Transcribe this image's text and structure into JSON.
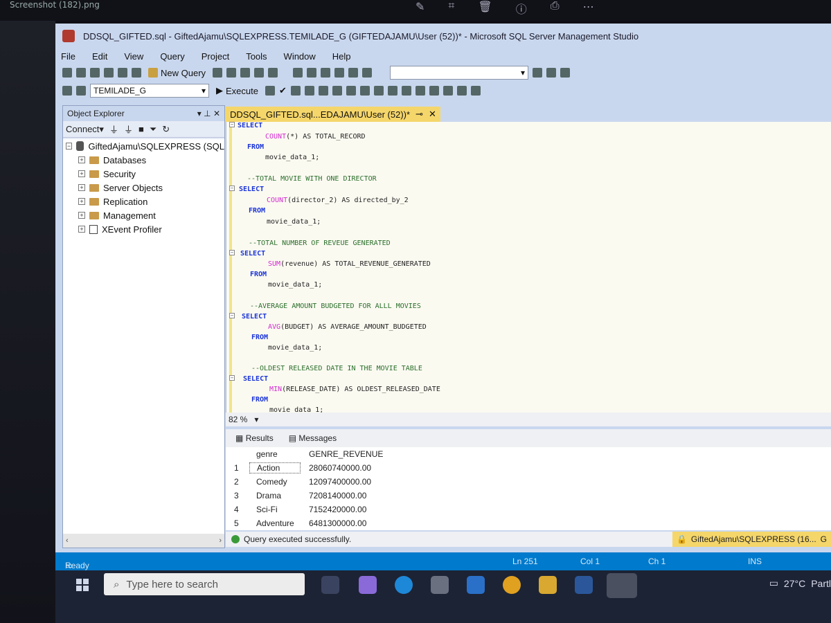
{
  "os": {
    "screenshot_file": "Screenshot (182).png"
  },
  "window": {
    "title": "DDSQL_GIFTED.sql - GiftedAjamu\\SQLEXPRESS.TEMILADE_G (GIFTEDAJAMU\\User (52))* - Microsoft SQL Server Management Studio"
  },
  "menu": [
    "File",
    "Edit",
    "View",
    "Query",
    "Project",
    "Tools",
    "Window",
    "Help"
  ],
  "toolbar": {
    "new_query_label": "New Query",
    "database_selected": "TEMILADE_G",
    "execute_label": "Execute"
  },
  "object_explorer": {
    "title": "Object Explorer",
    "connect_label": "Connect",
    "server_node": "GiftedAjamu\\SQLEXPRESS (SQL",
    "children": [
      "Databases",
      "Security",
      "Server Objects",
      "Replication",
      "Management",
      "XEvent Profiler"
    ]
  },
  "editor": {
    "tab_label": "DDSQL_GIFTED.sql...EDAJAMU\\User (52))*",
    "zoom": "82 %"
  },
  "code": {
    "l1_kw": "SELECT",
    "l2_fn": "COUNT",
    "l2_rest": "(*) AS TOTAL_RECORD",
    "l3_kw": "FROM",
    "l4": "movie_data_1;",
    "c1": "--TOTAL MOVIE WITH ONE DIRECTOR",
    "l6_kw": "SELECT",
    "l7_fn": "COUNT",
    "l7_rest": "(director_2) AS directed_by_2",
    "l8_kw": "FROM",
    "l9": "movie_data_1;",
    "c2": "--TOTAL NUMBER OF REVEUE GENERATED",
    "l11_kw": "SELECT",
    "l12_fn": "SUM",
    "l12_rest": "(revenue) AS TOTAL_REVENUE_GENERATED",
    "l13_kw": "FROM",
    "l14": "movie_data_1;",
    "c3": "--AVERAGE AMOUNT BUDGETED FOR ALLL MOVIES",
    "l16_kw": "SELECT",
    "l17_fn": "AVG",
    "l17_rest": "(BUDGET) AS AVERAGE_AMOUNT_BUDGETED",
    "l18_kw": "FROM",
    "l19": "movie_data_1;",
    "c4": "--OLDEST RELEASED DATE IN THE MOVIE TABLE",
    "l21_kw": "SELECT",
    "l22_fn": "MIN",
    "l22_rest": "(RELEASE_DATE) AS OLDEST_RELEASED_DATE",
    "l23_kw": "FROM",
    "l24": "movie data 1;"
  },
  "results": {
    "results_tab": "Results",
    "messages_tab": "Messages",
    "columns": [
      "genre",
      "GENRE_REVENUE"
    ],
    "rows": [
      {
        "n": "1",
        "genre": "Action",
        "revenue": "28060740000.00"
      },
      {
        "n": "2",
        "genre": "Comedy",
        "revenue": "12097400000.00"
      },
      {
        "n": "3",
        "genre": "Drama",
        "revenue": "7208140000.00"
      },
      {
        "n": "4",
        "genre": "Sci-Fi",
        "revenue": "7152420000.00"
      },
      {
        "n": "5",
        "genre": "Adventure",
        "revenue": "6481300000.00"
      }
    ],
    "status_message": "Query executed successfully.",
    "connection": "GiftedAjamu\\SQLEXPRESS (16...",
    "connection_extra": "G"
  },
  "statusbar": {
    "ready": "Ready",
    "line": "Ln 251",
    "col": "Col 1",
    "ch": "Ch 1",
    "mode": "INS"
  },
  "taskbar": {
    "search_placeholder": "Type here to search",
    "weather": "27°C",
    "weather_desc": "Partl"
  },
  "colors": {
    "accent": "#007acc",
    "tab_active": "#f5d66a",
    "keyword": "#1a34d8",
    "function": "#d22ad0",
    "comment": "#2a6e2a"
  }
}
